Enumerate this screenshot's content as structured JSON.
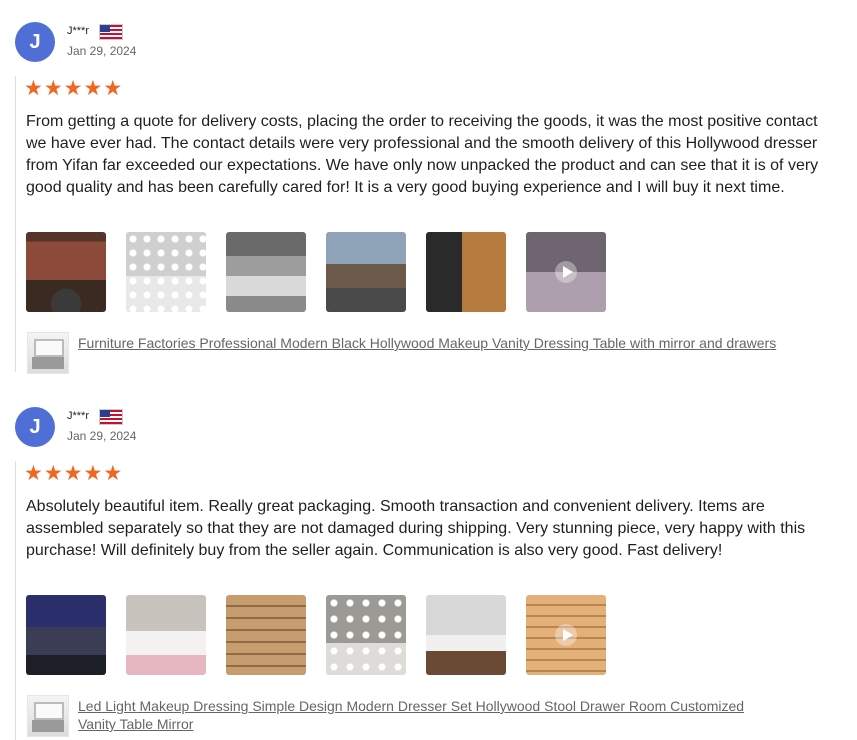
{
  "reviews": [
    {
      "avatar_letter": "J",
      "reviewer": "J***r",
      "country_flag": "us-flag-icon",
      "date": "Jan 29, 2024",
      "rating": 5,
      "text": "From getting a quote for delivery costs, placing the order to receiving the goods, it was the most positive contact we have ever had. The contact details were very professional and the smooth delivery of this Hollywood dresser from Yifan far exceeded our expectations. We have only now unpacked the product and can see that it is of very good quality and has been carefully cared for! It is a very good buying experience and I will buy it next time.",
      "photos": [
        "container-photo",
        "vanity-photo",
        "warehouse-photo",
        "forklift-photo",
        "boxes-photo",
        "vanity-video"
      ],
      "product_link": "Furniture Factories Professional Modern Black Hollywood Makeup Vanity Dressing Table with mirror and drawers"
    },
    {
      "avatar_letter": "J",
      "reviewer": "J***r",
      "country_flag": "us-flag-icon",
      "date": "Jan 29, 2024",
      "rating": 5,
      "text": "Absolutely beautiful item. Really great packaging. Smooth transaction and convenient delivery. Items are assembled separately so that they are not damaged during shipping. Very stunning piece, very happy with this purchase! Will definitely buy from the seller again. Communication is also very good. Fast delivery!",
      "photos": [
        "container-night-photo",
        "vanity-stool-photo",
        "stacked-boxes-photo",
        "mirror-vanity-photo",
        "room-vanity-photo",
        "pallet-video"
      ],
      "product_link": "Led Light Makeup Dressing Simple Design Modern Dresser Set Hollywood Stool Drawer Room Customized Vanity Table Mirror"
    }
  ],
  "colors": {
    "avatar": "#4f6fd6",
    "star": "#f16722",
    "link": "#666666"
  }
}
